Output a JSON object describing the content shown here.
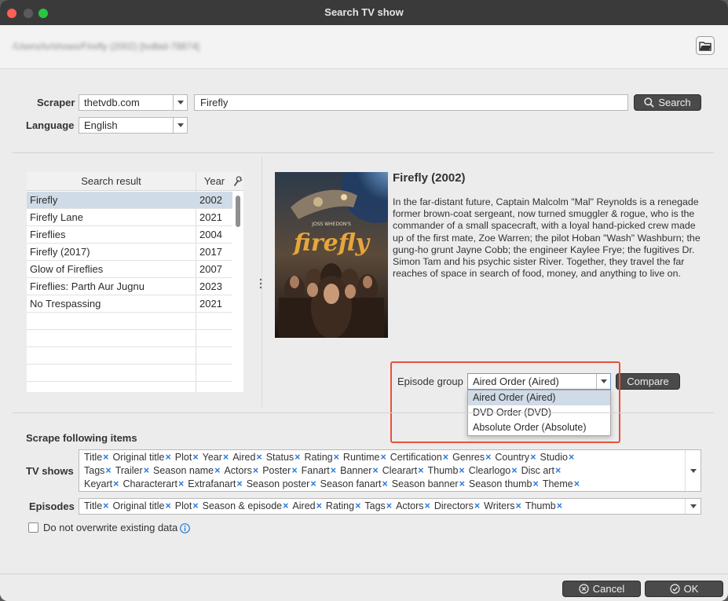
{
  "window": {
    "title": "Search TV show"
  },
  "path": {
    "text": "/Users/tv/shows/Firefly (2002) [tvdbid-78874]"
  },
  "search": {
    "scraper_label": "Scraper",
    "scraper_value": "thetvdb.com",
    "query": "Firefly",
    "button_label": "Search",
    "language_label": "Language",
    "language_value": "English"
  },
  "results": {
    "col_result": "Search result",
    "col_year": "Year",
    "rows": [
      {
        "name": "Firefly",
        "year": "2002"
      },
      {
        "name": "Firefly Lane",
        "year": "2021"
      },
      {
        "name": "Fireflies",
        "year": "2004"
      },
      {
        "name": "Firefly (2017)",
        "year": "2017"
      },
      {
        "name": "Glow of Fireflies",
        "year": "2007"
      },
      {
        "name": "Fireflies: Parth Aur Jugnu",
        "year": "2023"
      },
      {
        "name": "No Trespassing",
        "year": "2021"
      }
    ]
  },
  "detail": {
    "title": "Firefly (2002)",
    "plot": "In the far-distant future, Captain Malcolm \"Mal\" Reynolds is a renegade former brown-coat sergeant, now turned smuggler & rogue, who is the commander of a small spacecraft, with a loyal hand-picked crew made up of the first mate, Zoe Warren; the pilot Hoban \"Wash\" Washburn; the gung-ho grunt Jayne Cobb; the engineer Kaylee Frye; the fugitives Dr. Simon Tam and his psychic sister River. Together, they travel the far reaches of space in search of food, money, and anything to live on.",
    "poster_top_text": "JOSS WHEDON'S",
    "poster_title": "firefly"
  },
  "episode_group": {
    "label": "Episode group",
    "value": "Aired Order (Aired)",
    "compare_label": "Compare",
    "options": [
      "Aired Order (Aired)",
      "DVD Order (DVD)",
      "Absolute Order (Absolute)"
    ]
  },
  "scrape": {
    "heading": "Scrape following items",
    "tv_label": "TV shows",
    "tv_items": [
      [
        "Title",
        "Original title",
        "Plot",
        "Year",
        "Aired",
        "Status",
        "Rating",
        "Runtime",
        "Certification",
        "Genres",
        "Country",
        "Studio"
      ],
      [
        "Tags",
        "Trailer",
        "Season name",
        "Actors",
        "Poster",
        "Fanart",
        "Banner",
        "Clearart",
        "Thumb",
        "Clearlogo",
        "Disc art"
      ],
      [
        "Keyart",
        "Characterart",
        "Extrafanart",
        "Season poster",
        "Season fanart",
        "Season banner",
        "Season thumb",
        "Theme"
      ]
    ],
    "ep_label": "Episodes",
    "ep_items": [
      "Title",
      "Original title",
      "Plot",
      "Season & episode",
      "Aired",
      "Rating",
      "Tags",
      "Actors",
      "Directors",
      "Writers",
      "Thumb"
    ],
    "overwrite_label": "Do not overwrite existing data"
  },
  "footer": {
    "cancel_label": "Cancel",
    "ok_label": "OK"
  },
  "colors": {
    "highlight": "#e8513c",
    "selection": "#cfdbe6",
    "tag_x": "#2a7bd6",
    "titlebar": "#3a3a3a"
  }
}
